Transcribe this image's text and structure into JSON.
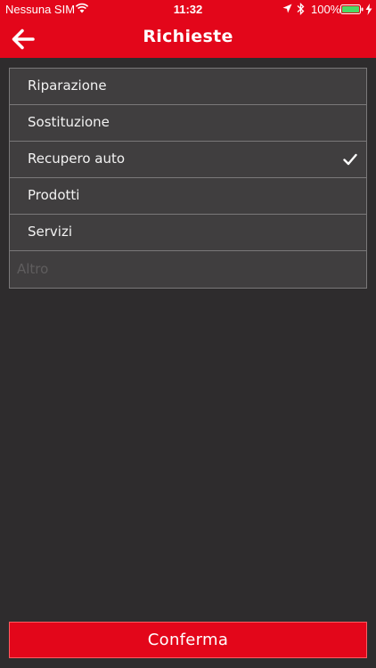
{
  "status_bar": {
    "carrier": "Nessuna SIM",
    "time": "11:32",
    "battery_percent": "100%"
  },
  "nav": {
    "title": "Richieste"
  },
  "items": [
    {
      "label": "Riparazione",
      "selected": false
    },
    {
      "label": "Sostituzione",
      "selected": false
    },
    {
      "label": "Recupero auto",
      "selected": true
    },
    {
      "label": "Prodotti",
      "selected": false
    },
    {
      "label": "Servizi",
      "selected": false
    }
  ],
  "other": {
    "placeholder": "Altro",
    "value": ""
  },
  "confirm_label": "Conferma",
  "colors": {
    "brand_red": "#e3061a",
    "background": "#2e2c2d",
    "row_background": "#403e3f",
    "divider": "#7a7879"
  },
  "icons": {
    "back": "arrow-left-icon",
    "selected": "check-icon"
  }
}
